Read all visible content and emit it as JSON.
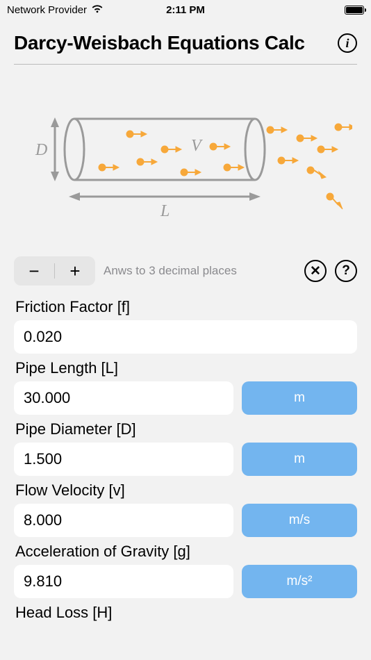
{
  "status": {
    "provider": "Network Provider",
    "time": "2:11 PM"
  },
  "header": {
    "title": "Darcy-Weisbach Equations Calc",
    "info_glyph": "i"
  },
  "diagram": {
    "d_label": "D",
    "v_label": "V",
    "l_label": "L"
  },
  "controls": {
    "minus": "−",
    "plus": "+",
    "decimal_hint": "Anws to 3 decimal places",
    "clear_glyph": "✕",
    "help_glyph": "?"
  },
  "fields": [
    {
      "label": "Friction Factor [f]",
      "value": "0.020",
      "unit": null
    },
    {
      "label": "Pipe Length [L]",
      "value": "30.000",
      "unit": "m"
    },
    {
      "label": "Pipe Diameter [D]",
      "value": "1.500",
      "unit": "m"
    },
    {
      "label": "Flow Velocity [v]",
      "value": "8.000",
      "unit": "m/s"
    },
    {
      "label": "Acceleration of Gravity [g]",
      "value": "9.810",
      "unit": "m/s²"
    }
  ],
  "partial_next_label": "Head Loss [H]",
  "colors": {
    "unit_button": "#73b5ef",
    "particle": "#f7a83a",
    "pipe": "#9a9a9a"
  }
}
